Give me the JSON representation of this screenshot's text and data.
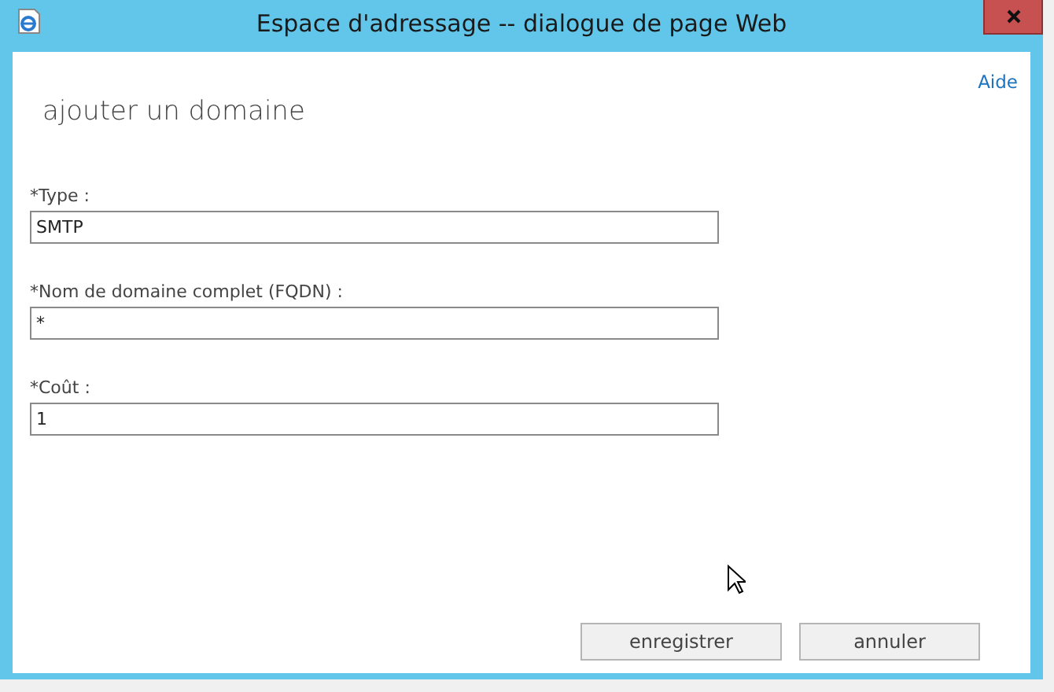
{
  "window": {
    "title": "Espace d'adressage -- dialogue de page Web"
  },
  "help_link": "Aide",
  "heading": "ajouter un domaine",
  "fields": [
    {
      "label": "*Type :",
      "value": "SMTP"
    },
    {
      "label": "*Nom de domaine complet (FQDN) :",
      "value": "*"
    },
    {
      "label": "*Coût :",
      "value": "1"
    }
  ],
  "buttons": [
    {
      "label": "enregistrer"
    },
    {
      "label": "annuler"
    }
  ]
}
